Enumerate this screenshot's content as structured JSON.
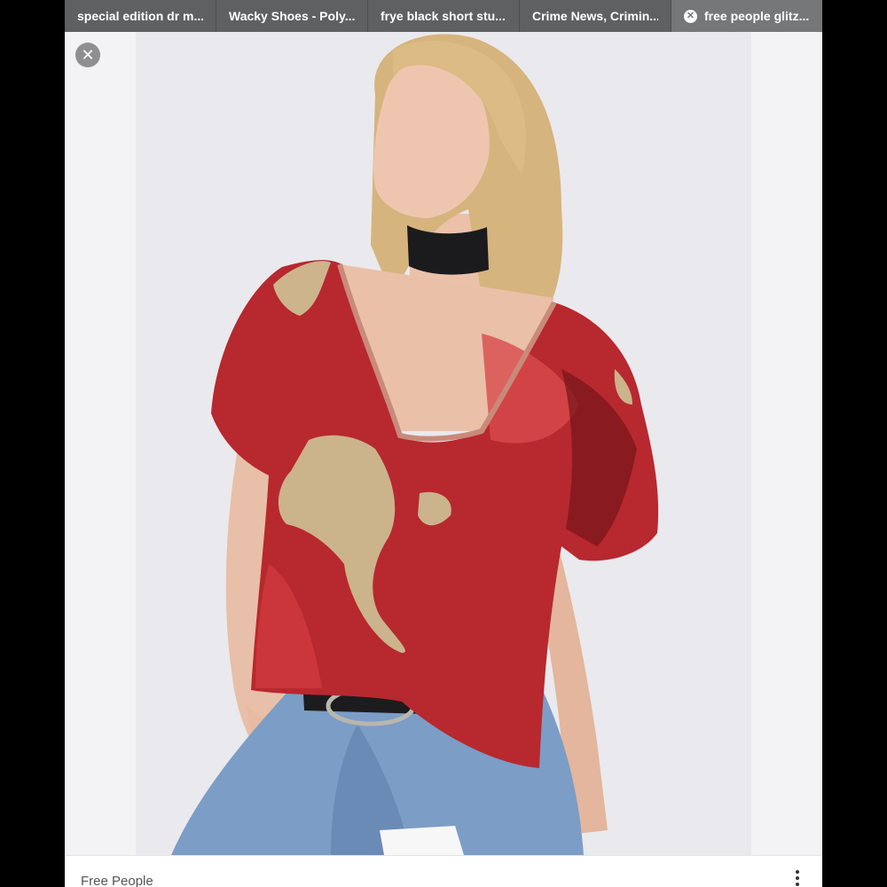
{
  "tabs": [
    {
      "label": "special edition dr m..."
    },
    {
      "label": "Wacky Shoes - Poly..."
    },
    {
      "label": "frye black short stu..."
    },
    {
      "label": "Crime News, Crimin..."
    },
    {
      "label": "free people glitz...",
      "active": true,
      "close_icon": "close-circle-icon"
    }
  ],
  "viewer": {
    "close_icon": "close-icon",
    "close_glyph": "✕",
    "tab_close_glyph": "✕",
    "image": {
      "subject": "model wearing red and gold sequin v-neck top with black choker and blue jeans",
      "colors": {
        "sequin_red": "#b8282f",
        "sequin_gold": "#cbb38c",
        "choker": "#1a1a1a",
        "denim": "#7b9cc4",
        "skin": "#ebc3ac",
        "hair": "#d4b27a"
      }
    }
  },
  "caption": {
    "source": "Free People",
    "more_icon": "more-vertical-icon"
  }
}
